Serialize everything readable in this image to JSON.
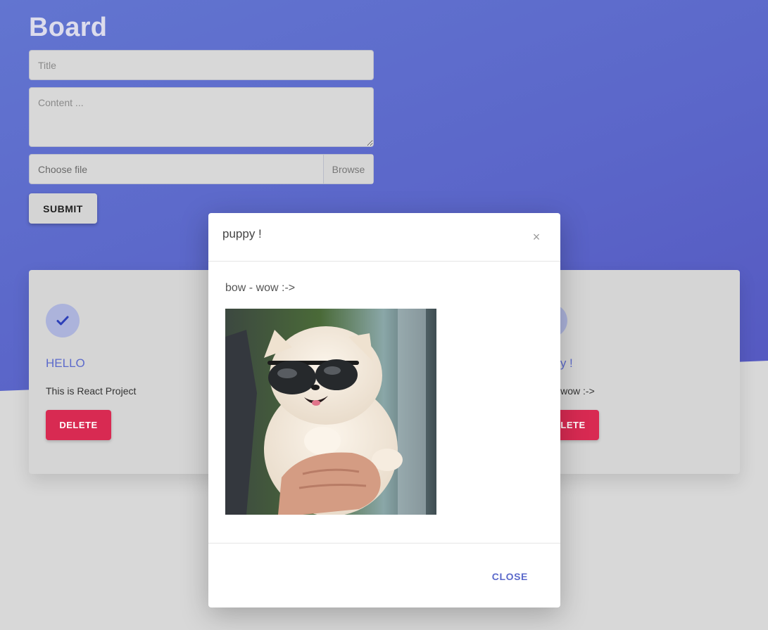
{
  "header": {
    "title": "Board"
  },
  "form": {
    "title_placeholder": "Title",
    "content_placeholder": "Content ...",
    "file_label": "Choose file",
    "browse_label": "Browse",
    "submit_label": "SUBMIT"
  },
  "cards": [
    {
      "title": "HELLO",
      "content": "This is React Project",
      "delete_label": "DELETE",
      "icon": "check-icon"
    },
    {
      "title": "puppy !",
      "content": "bow - wow :->",
      "delete_label": "DELETE",
      "icon": "check-icon"
    }
  ],
  "modal": {
    "title": "puppy !",
    "close_symbol": "×",
    "body_text": "bow - wow :->",
    "image": "puppy-with-sunglasses-photo",
    "close_label": "CLOSE"
  },
  "colors": {
    "brand": "#5c6acb",
    "delete": "#d82a52",
    "background_top": "#6275d0",
    "background_bottom": "#d8d8d8"
  }
}
